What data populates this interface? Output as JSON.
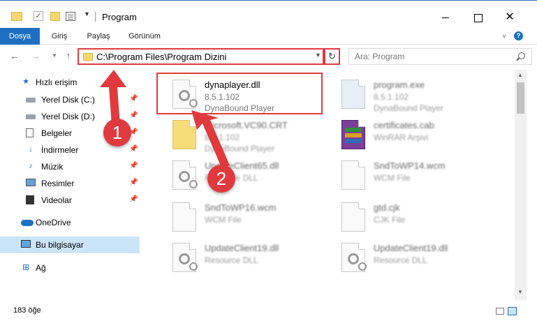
{
  "window": {
    "title": "Program",
    "minimize_label": "",
    "maximize_label": "",
    "close_label": "✕"
  },
  "ribbon": {
    "tabs": [
      {
        "label": "Dosya",
        "active": true
      },
      {
        "label": "Giriş"
      },
      {
        "label": "Paylaş"
      },
      {
        "label": "Görünüm"
      }
    ],
    "help": "?"
  },
  "address": {
    "path": "C:\\Program Files\\Program Dizini",
    "refresh": "↻"
  },
  "search": {
    "placeholder": "Ara: Program"
  },
  "sidebar": {
    "items": [
      {
        "label": "Hızlı erişim",
        "icon": "star-icon"
      },
      {
        "label": "Yerel Disk (C:)",
        "icon": "drive-icon",
        "pinned": true
      },
      {
        "label": "Yerel Disk (D:)",
        "icon": "drive-icon",
        "pinned": true
      },
      {
        "label": "Belgeler",
        "icon": "document-icon",
        "pinned": true
      },
      {
        "label": "İndirmeler",
        "icon": "download-icon",
        "pinned": true
      },
      {
        "label": "Müzik",
        "icon": "music-icon",
        "pinned": true
      },
      {
        "label": "Resimler",
        "icon": "pictures-icon",
        "pinned": true
      },
      {
        "label": "Videolar",
        "icon": "video-icon",
        "pinned": true
      },
      {
        "label": "OneDrive",
        "icon": "cloud-icon"
      },
      {
        "label": "Bu bilgisayar",
        "icon": "computer-icon",
        "selected": true
      },
      {
        "label": "Ağ",
        "icon": "network-icon"
      }
    ]
  },
  "files": [
    {
      "name": "dynaplayer.dll",
      "line1": "8.5.1.102",
      "line2": "DynaBound Player",
      "icon": "dll-gear-icon",
      "highlighted": true
    },
    {
      "name": "program.exe",
      "line1": "8.5.1.102",
      "line2": "DynaBound Player",
      "icon": "exe-icon"
    },
    {
      "name": "Microsoft.VC90.CRT",
      "line1": "8.5.1.102",
      "line2": "DynaBound Player",
      "icon": "folder-icon"
    },
    {
      "name": "certificates.cab",
      "line1": "WinRAR Arşivi",
      "line2": "",
      "icon": "winrar-icon"
    },
    {
      "name": "UpdateClient65.dll",
      "line1": "Resource DLL",
      "line2": "",
      "icon": "dll-gear-icon"
    },
    {
      "name": "SndToWP14.wcm",
      "line1": "WCM File",
      "line2": "",
      "icon": "file-icon"
    },
    {
      "name": "SndToWP16.wcm",
      "line1": "WCM File",
      "line2": "",
      "icon": "file-icon"
    },
    {
      "name": "gtd.cjk",
      "line1": "CJK File",
      "line2": "",
      "icon": "file-icon"
    },
    {
      "name": "UpdateClient19.dll",
      "line1": "Resource DLL",
      "line2": "",
      "icon": "dll-gear-icon"
    },
    {
      "name": "UpdateClient19.dll",
      "line1": "Resource DLL",
      "line2": "",
      "icon": "dll-gear-icon"
    }
  ],
  "status": {
    "count": "183 öğe"
  },
  "annotations": {
    "step1": "1",
    "step2": "2",
    "color": "#e03a3e"
  },
  "colors": {
    "accent": "#1e6fc1",
    "selection": "#cce4f7"
  }
}
